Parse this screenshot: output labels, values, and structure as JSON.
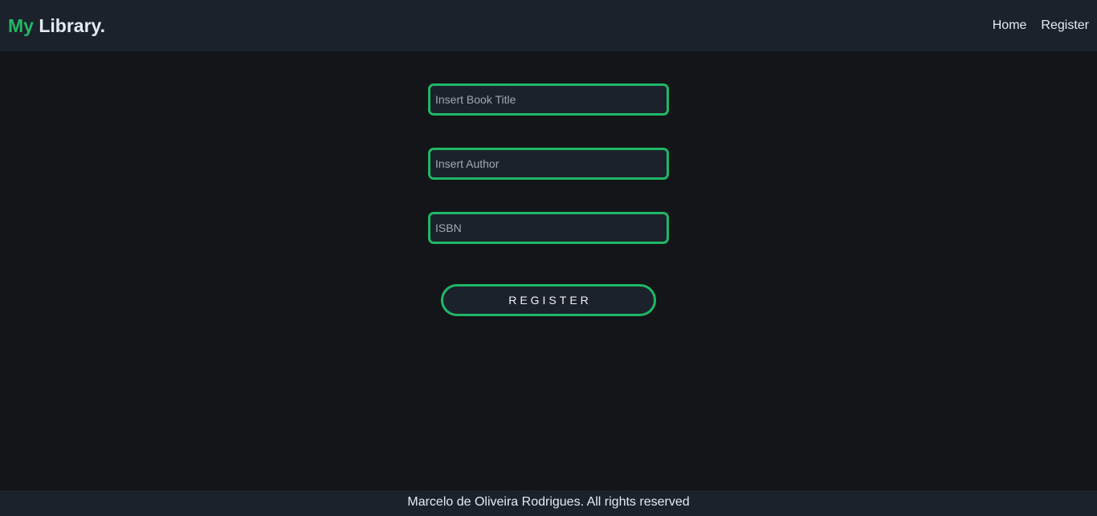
{
  "header": {
    "logo_first": "My",
    "logo_rest": "Library.",
    "nav": [
      {
        "label": "Home"
      },
      {
        "label": "Register"
      }
    ]
  },
  "form": {
    "title_placeholder": "Insert Book Title",
    "author_placeholder": "Insert Author",
    "isbn_placeholder": "ISBN",
    "submit_label": "REGISTER"
  },
  "footer": {
    "text": "Marcelo de Oliveira Rodrigues. All rights reserved"
  },
  "colors": {
    "accent": "#1fb765",
    "background": "#131519",
    "surface": "#1c222c"
  }
}
